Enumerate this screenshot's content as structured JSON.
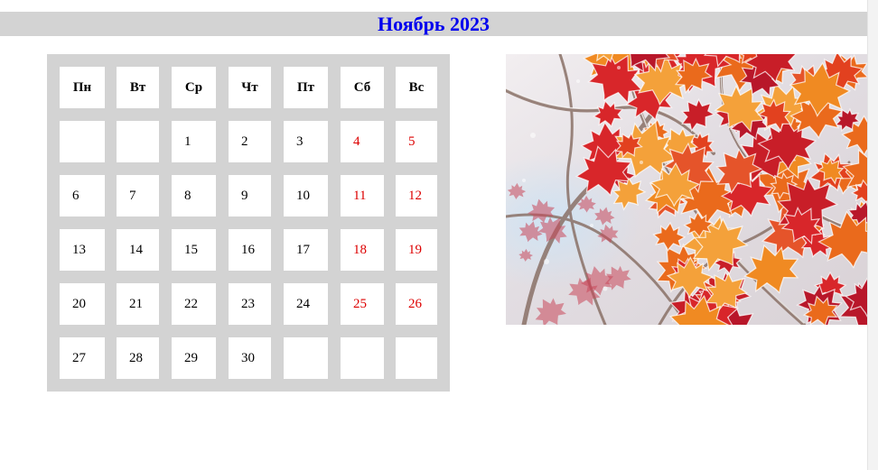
{
  "title": "Ноябрь 2023",
  "weekdays": [
    "Пн",
    "Вт",
    "Ср",
    "Чт",
    "Пт",
    "Сб",
    "Вс"
  ],
  "weeks": [
    [
      "",
      "",
      "1",
      "2",
      "3",
      "4",
      "5"
    ],
    [
      "6",
      "7",
      "8",
      "9",
      "10",
      "11",
      "12"
    ],
    [
      "13",
      "14",
      "15",
      "16",
      "17",
      "18",
      "19"
    ],
    [
      "20",
      "21",
      "22",
      "23",
      "24",
      "25",
      "26"
    ],
    [
      "27",
      "28",
      "29",
      "30",
      "",
      "",
      ""
    ]
  ],
  "weekend_columns": [
    5,
    6
  ],
  "colors": {
    "title": "#0000ee",
    "title_bar": "#d3d3d3",
    "calendar_bg": "#d3d3d3",
    "weekend_text": "#dd0000",
    "day_text": "#000000"
  },
  "image": {
    "subject": "frosted red autumn maple leaves"
  }
}
